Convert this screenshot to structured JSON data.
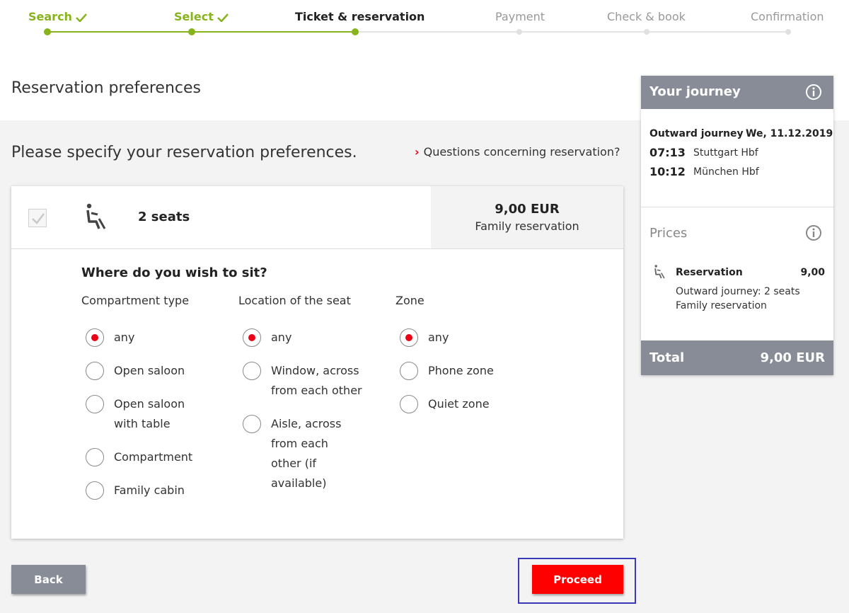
{
  "stepper": {
    "steps": [
      {
        "label": "Search",
        "state": "done"
      },
      {
        "label": "Select",
        "state": "done"
      },
      {
        "label": "Ticket & reservation",
        "state": "active"
      },
      {
        "label": "Payment",
        "state": "todo"
      },
      {
        "label": "Check & book",
        "state": "todo"
      },
      {
        "label": "Confirmation",
        "state": "todo"
      }
    ]
  },
  "page": {
    "title": "Reservation preferences",
    "subtitle": "Please specify your reservation preferences.",
    "faq_link": "Questions concerning reservation?"
  },
  "reservation": {
    "seats": "2 seats",
    "price": "9,00 EUR",
    "type": "Family reservation",
    "question": "Where do you wish to sit?",
    "compartment": {
      "title": "Compartment type",
      "options": [
        "any",
        "Open saloon",
        "Open saloon with table",
        "Compartment",
        "Family cabin"
      ],
      "selected": "any"
    },
    "location": {
      "title": "Location of the seat",
      "options": [
        "any",
        "Window, across from each other",
        "Aisle, across from each other (if available)"
      ],
      "selected": "any"
    },
    "zone": {
      "title": "Zone",
      "options": [
        "any",
        "Phone zone",
        "Quiet zone"
      ],
      "selected": "any"
    }
  },
  "journey": {
    "title": "Your journey",
    "outward_label": "Outward journey",
    "date": "We, 11.12.2019",
    "departure_time": "07:13",
    "departure_station": "Stuttgart Hbf",
    "arrival_time": "10:12",
    "arrival_station": "München Hbf",
    "prices_title": "Prices",
    "item_label": "Reservation",
    "item_value": "9,00",
    "item_detail_1": "Outward journey: 2 seats",
    "item_detail_2": "Family reservation",
    "total_label": "Total",
    "total_value": "9,00 EUR"
  },
  "actions": {
    "back": "Back",
    "proceed": "Proceed"
  },
  "colors": {
    "accent_green": "#87b41c",
    "brand_red": "#ec0016",
    "panel_gray": "#878c96",
    "highlight_frame": "#3a3ab8"
  }
}
